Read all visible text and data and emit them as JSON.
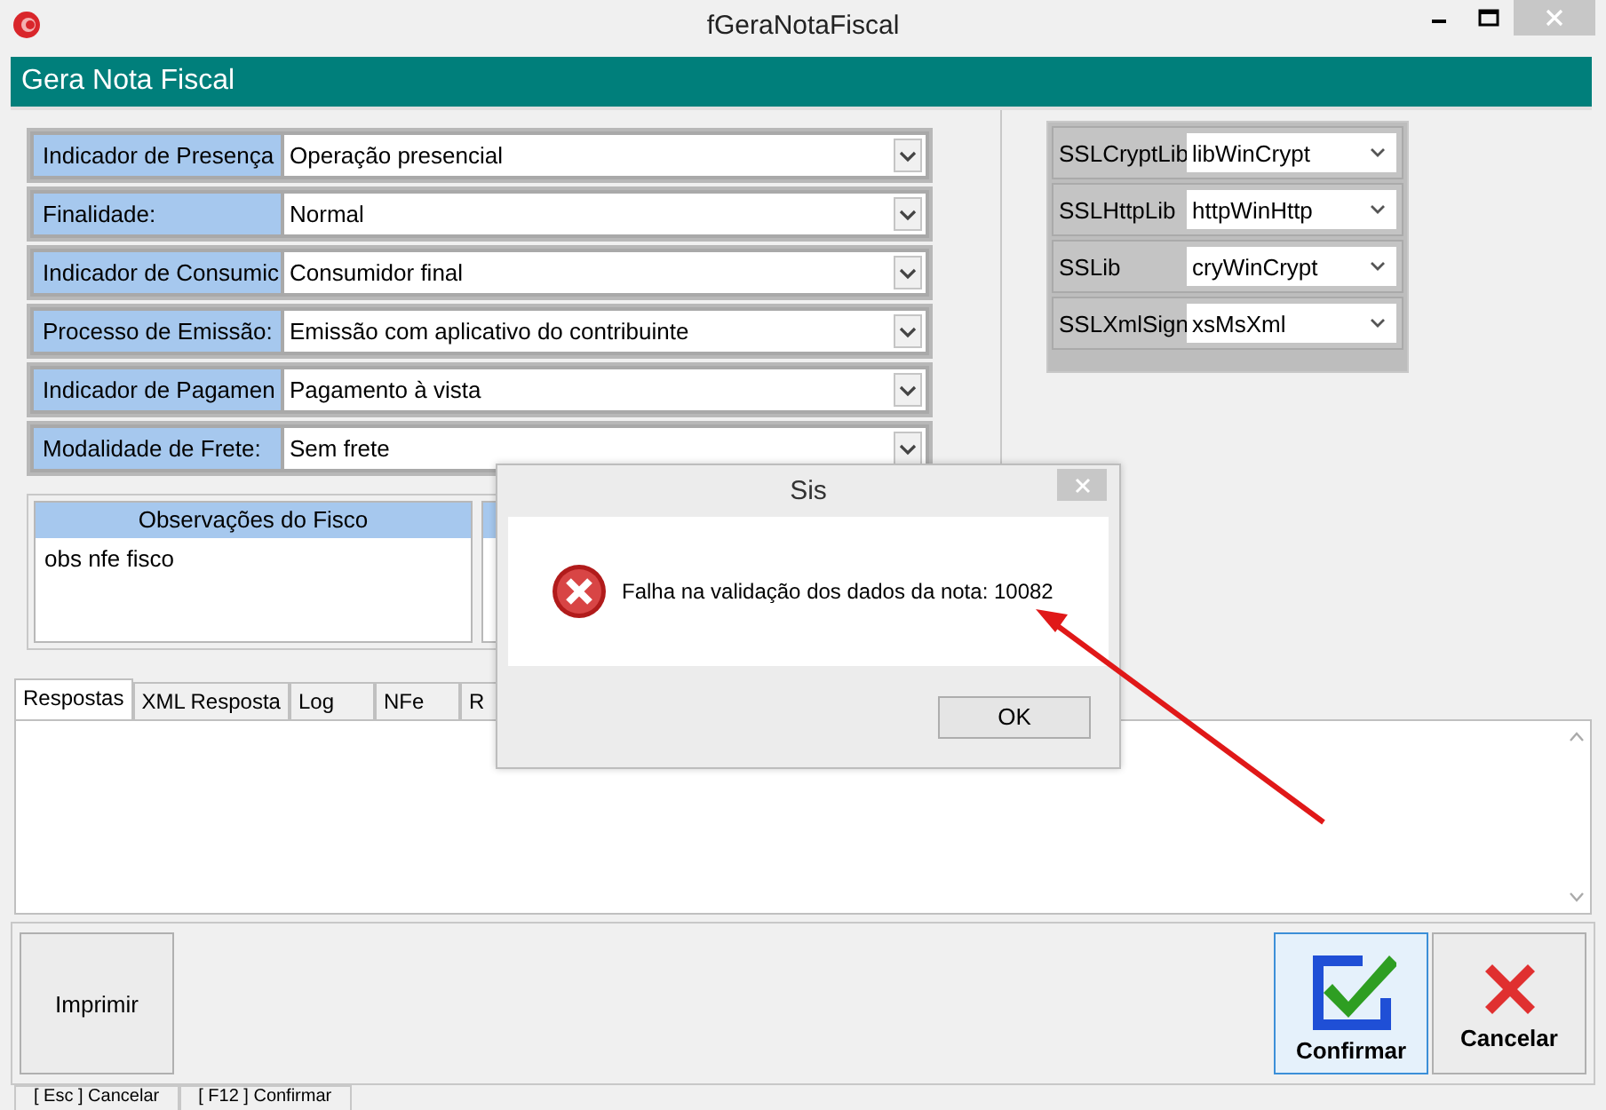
{
  "window": {
    "title": "fGeraNotaFiscal"
  },
  "header": {
    "title": "Gera Nota Fiscal"
  },
  "fields": [
    {
      "label": "Indicador de Presença",
      "value": "Operação presencial"
    },
    {
      "label": "Finalidade:",
      "value": "Normal"
    },
    {
      "label": "Indicador de Consumic",
      "value": "Consumidor final"
    },
    {
      "label": "Processo de Emissão:",
      "value": "Emissão com aplicativo do contribuinte"
    },
    {
      "label": "Indicador de Pagamen",
      "value": "Pagamento à vista"
    },
    {
      "label": "Modalidade de Frete:",
      "value": "Sem frete"
    }
  ],
  "ssl_settings": [
    {
      "label": "SSLCryptLib",
      "value": "libWinCrypt"
    },
    {
      "label": "SSLHttpLib",
      "value": "httpWinHttp"
    },
    {
      "label": "SSLib",
      "value": "cryWinCrypt"
    },
    {
      "label": "SSLXmlSign",
      "value": "xsMsXml"
    }
  ],
  "observations": [
    {
      "title": "Observações do Fisco",
      "text": "obs nfe fisco"
    }
  ],
  "tabs": [
    {
      "label": "Respostas",
      "selected": true
    },
    {
      "label": "XML Resposta",
      "selected": false
    },
    {
      "label": "Log",
      "selected": false
    },
    {
      "label": "NFe",
      "selected": false
    },
    {
      "label": "R",
      "selected": false
    }
  ],
  "buttons": [
    {
      "label": "Imprimir",
      "kind": "plain",
      "focused": false
    },
    {
      "label": "Confirmar",
      "kind": "confirm",
      "focused": true
    },
    {
      "label": "Cancelar",
      "kind": "cancel",
      "focused": false
    }
  ],
  "status_bar": [
    "[ Esc ] Cancelar",
    "[ F12 ] Confirmar"
  ],
  "dialog": {
    "title": "Sis",
    "message": "Falha na validação dos dados da nota: 10082",
    "button": "OK"
  }
}
